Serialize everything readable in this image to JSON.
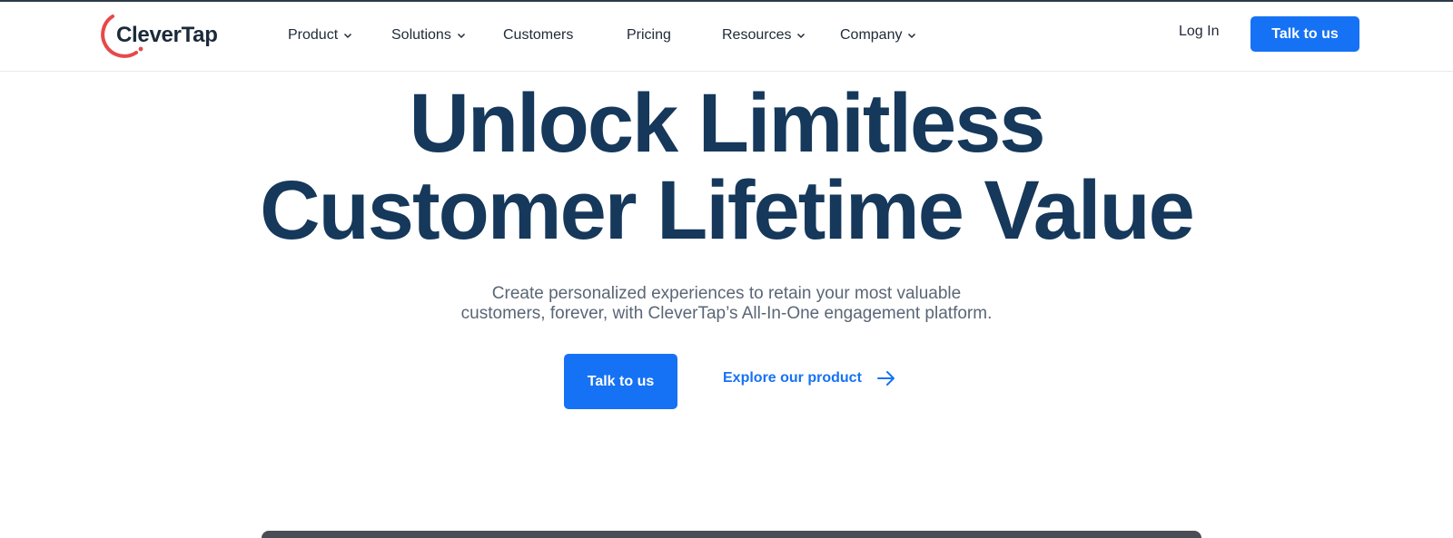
{
  "brand": {
    "name": "CleverTap",
    "accent": "#e8484a",
    "primary": "#1672f4",
    "heading_color": "#15385b"
  },
  "nav": {
    "items": [
      {
        "label": "Product",
        "has_dropdown": true
      },
      {
        "label": "Solutions",
        "has_dropdown": true
      },
      {
        "label": "Customers",
        "has_dropdown": false
      },
      {
        "label": "Pricing",
        "has_dropdown": false
      },
      {
        "label": "Resources",
        "has_dropdown": true
      },
      {
        "label": "Company",
        "has_dropdown": true
      }
    ],
    "login_label": "Log In",
    "cta_label": "Talk to us"
  },
  "hero": {
    "title_line1": "Unlock Limitless",
    "title_line2": "Customer Lifetime Value",
    "subtitle_line1": "Create personalized experiences to retain your most valuable",
    "subtitle_line2": "customers, forever, with CleverTap’s All-In-One engagement platform.",
    "cta_label": "Talk to us",
    "secondary_label": "Explore our product",
    "secondary_icon": "arrow-right-icon"
  }
}
